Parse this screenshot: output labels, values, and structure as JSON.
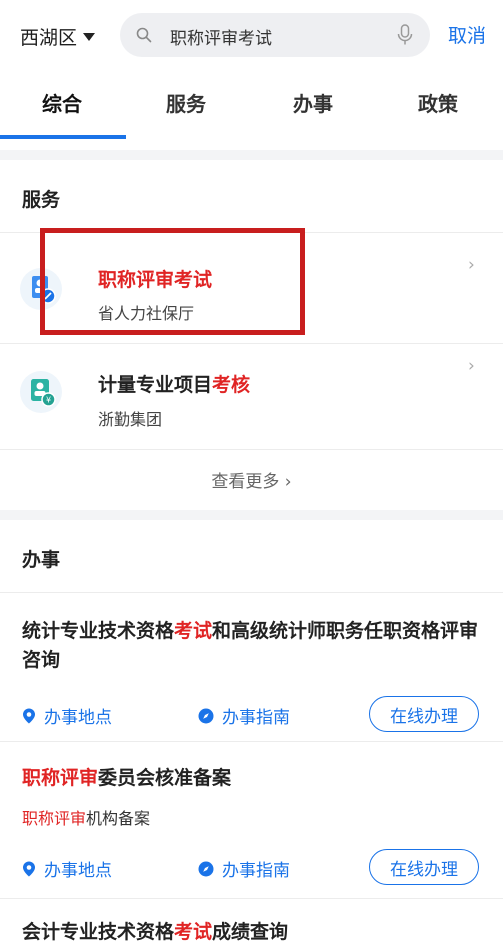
{
  "header": {
    "region": "西湖区",
    "search_value": "职称评审考试",
    "cancel": "取消"
  },
  "tabs": [
    {
      "label": "综合",
      "active": true
    },
    {
      "label": "服务",
      "active": false
    },
    {
      "label": "办事",
      "active": false
    },
    {
      "label": "政策",
      "active": false
    }
  ],
  "services": {
    "title": "服务",
    "items": [
      {
        "title_parts": [
          "职称评审考试",
          ""
        ],
        "subtitle": "省人力社保厅",
        "highlighted": true,
        "icon": "person-card-icon"
      },
      {
        "title_parts": [
          "计量专业项目",
          "考核"
        ],
        "subtitle": "浙勤集团",
        "highlighted": false,
        "icon": "id-card-icon"
      }
    ],
    "more": "查看更多 ›"
  },
  "affairs": {
    "title": "办事",
    "items": [
      {
        "title_a": "统计专业技术资格",
        "title_hl": "考试",
        "title_b": "和高级统计师职务任职资格评审咨询",
        "location": "办事地点",
        "guide": "办事指南",
        "online": "在线办理"
      },
      {
        "title_hl": "职称评审",
        "title_b": "委员会核准备案",
        "sub_hl": "职称评审",
        "sub_b": "机构备案",
        "location": "办事地点",
        "guide": "办事指南",
        "online": "在线办理"
      },
      {
        "title_a": "会计专业技术资格",
        "title_hl": "考试",
        "title_b": "成绩查询"
      }
    ]
  },
  "colors": {
    "accent": "#1a73e8",
    "highlight": "#e02424",
    "box": "#c81e1e"
  }
}
